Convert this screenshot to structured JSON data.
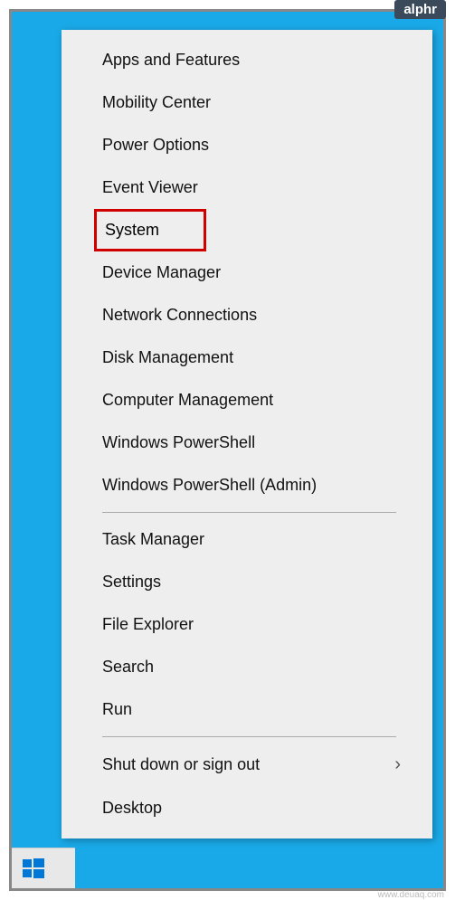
{
  "badge": "alphr",
  "watermark": "www.deuaq.com",
  "menu": {
    "group1": [
      "Apps and Features",
      "Mobility Center",
      "Power Options",
      "Event Viewer",
      "System",
      "Device Manager",
      "Network Connections",
      "Disk Management",
      "Computer Management",
      "Windows PowerShell",
      "Windows PowerShell (Admin)"
    ],
    "group2": [
      "Task Manager",
      "Settings",
      "File Explorer",
      "Search",
      "Run"
    ],
    "group3_submenu": "Shut down or sign out",
    "group3_last": "Desktop"
  },
  "highlighted_index": 4,
  "colors": {
    "desktop_bg": "#1aa9e8",
    "menu_bg": "#eeeeee",
    "highlight_border": "#d00000"
  }
}
